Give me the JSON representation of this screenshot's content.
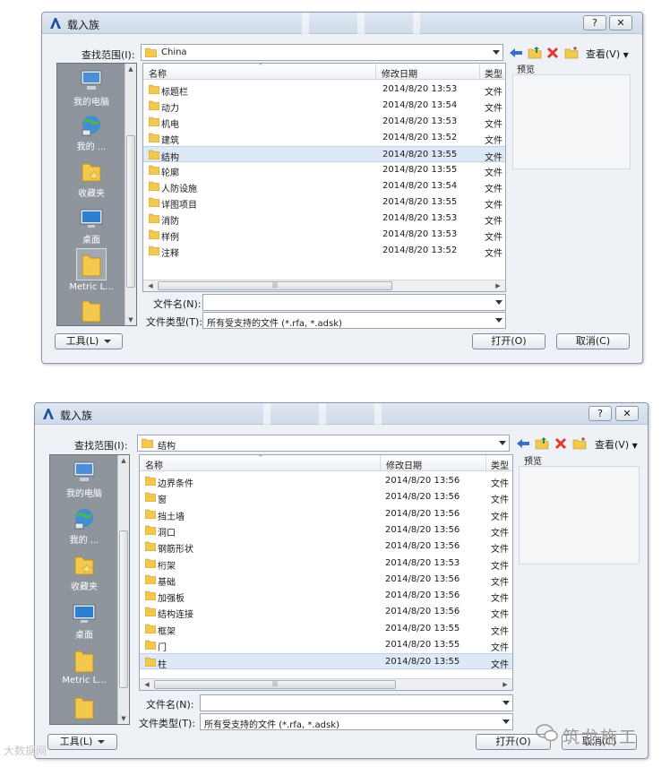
{
  "dialog1": {
    "title": "载入族",
    "help": "?",
    "close": "✕",
    "lookin_label": "查找范围(I):",
    "lookin_value": "China",
    "views_label": "查看(V)",
    "preview_label": "预览",
    "places": [
      {
        "label": "我的电脑",
        "icon": "computer-icon"
      },
      {
        "label": "我的 ...",
        "icon": "network-icon"
      },
      {
        "label": "收藏夹",
        "icon": "favorites-icon"
      },
      {
        "label": "桌面",
        "icon": "desktop-icon"
      },
      {
        "label": "Metric L...",
        "icon": "folder-icon"
      },
      {
        "label": "",
        "icon": "folder-icon"
      }
    ],
    "columns": {
      "name": "名称",
      "date": "修改日期",
      "type": "类型"
    },
    "files": [
      {
        "name": "标题栏",
        "date": "2014/8/20 13:53",
        "type": "文件"
      },
      {
        "name": "动力",
        "date": "2014/8/20 13:54",
        "type": "文件"
      },
      {
        "name": "机电",
        "date": "2014/8/20 13:53",
        "type": "文件"
      },
      {
        "name": "建筑",
        "date": "2014/8/20 13:52",
        "type": "文件"
      },
      {
        "name": "结构",
        "date": "2014/8/20 13:55",
        "type": "文件",
        "selected": true
      },
      {
        "name": "轮廓",
        "date": "2014/8/20 13:55",
        "type": "文件"
      },
      {
        "name": "人防设施",
        "date": "2014/8/20 13:54",
        "type": "文件"
      },
      {
        "name": "详图项目",
        "date": "2014/8/20 13:55",
        "type": "文件"
      },
      {
        "name": "消防",
        "date": "2014/8/20 13:53",
        "type": "文件"
      },
      {
        "name": "样例",
        "date": "2014/8/20 13:53",
        "type": "文件"
      },
      {
        "name": "注释",
        "date": "2014/8/20 13:52",
        "type": "文件"
      }
    ],
    "filename_label": "文件名(N):",
    "filename_value": "",
    "filetype_label": "文件类型(T):",
    "filetype_value": "所有受支持的文件 (*.rfa, *.adsk)",
    "tools_label": "工具(L)",
    "open_label": "打开(O)",
    "cancel_label": "取消(C)"
  },
  "dialog2": {
    "title": "载入族",
    "help": "?",
    "close": "✕",
    "lookin_label": "查找范围(I):",
    "lookin_value": "结构",
    "views_label": "查看(V)",
    "preview_label": "预览",
    "places": [
      {
        "label": "我的电脑",
        "icon": "computer-icon"
      },
      {
        "label": "我的 ...",
        "icon": "network-icon"
      },
      {
        "label": "收藏夹",
        "icon": "favorites-icon"
      },
      {
        "label": "桌面",
        "icon": "desktop-icon"
      },
      {
        "label": "Metric L...",
        "icon": "folder-icon"
      },
      {
        "label": "",
        "icon": "folder-icon"
      }
    ],
    "columns": {
      "name": "名称",
      "date": "修改日期",
      "type": "类型"
    },
    "files": [
      {
        "name": "边界条件",
        "date": "2014/8/20 13:56",
        "type": "文件"
      },
      {
        "name": "窗",
        "date": "2014/8/20 13:56",
        "type": "文件"
      },
      {
        "name": "挡土墙",
        "date": "2014/8/20 13:56",
        "type": "文件"
      },
      {
        "name": "洞口",
        "date": "2014/8/20 13:56",
        "type": "文件"
      },
      {
        "name": "钢筋形状",
        "date": "2014/8/20 13:56",
        "type": "文件"
      },
      {
        "name": "桁架",
        "date": "2014/8/20 13:53",
        "type": "文件"
      },
      {
        "name": "基础",
        "date": "2014/8/20 13:56",
        "type": "文件"
      },
      {
        "name": "加强板",
        "date": "2014/8/20 13:56",
        "type": "文件"
      },
      {
        "name": "结构连接",
        "date": "2014/8/20 13:56",
        "type": "文件"
      },
      {
        "name": "框架",
        "date": "2014/8/20 13:55",
        "type": "文件"
      },
      {
        "name": "门",
        "date": "2014/8/20 13:55",
        "type": "文件"
      },
      {
        "name": "柱",
        "date": "2014/8/20 13:55",
        "type": "文件",
        "selected": true
      }
    ],
    "filename_label": "文件名(N):",
    "filename_value": "",
    "filetype_label": "文件类型(T):",
    "filetype_value": "所有受支持的文件 (*.rfa, *.adsk)",
    "tools_label": "工具(L)",
    "open_label": "打开(O)",
    "cancel_label": "取消(C)"
  },
  "watermarks": {
    "top_left": "大数据网",
    "bottom_right": "筑龙施工"
  },
  "colors": {
    "folder": "#f2c94c",
    "delete": "#e03a2f",
    "back_arrow": "#3b6fc4",
    "selection": "#dde9f6"
  }
}
